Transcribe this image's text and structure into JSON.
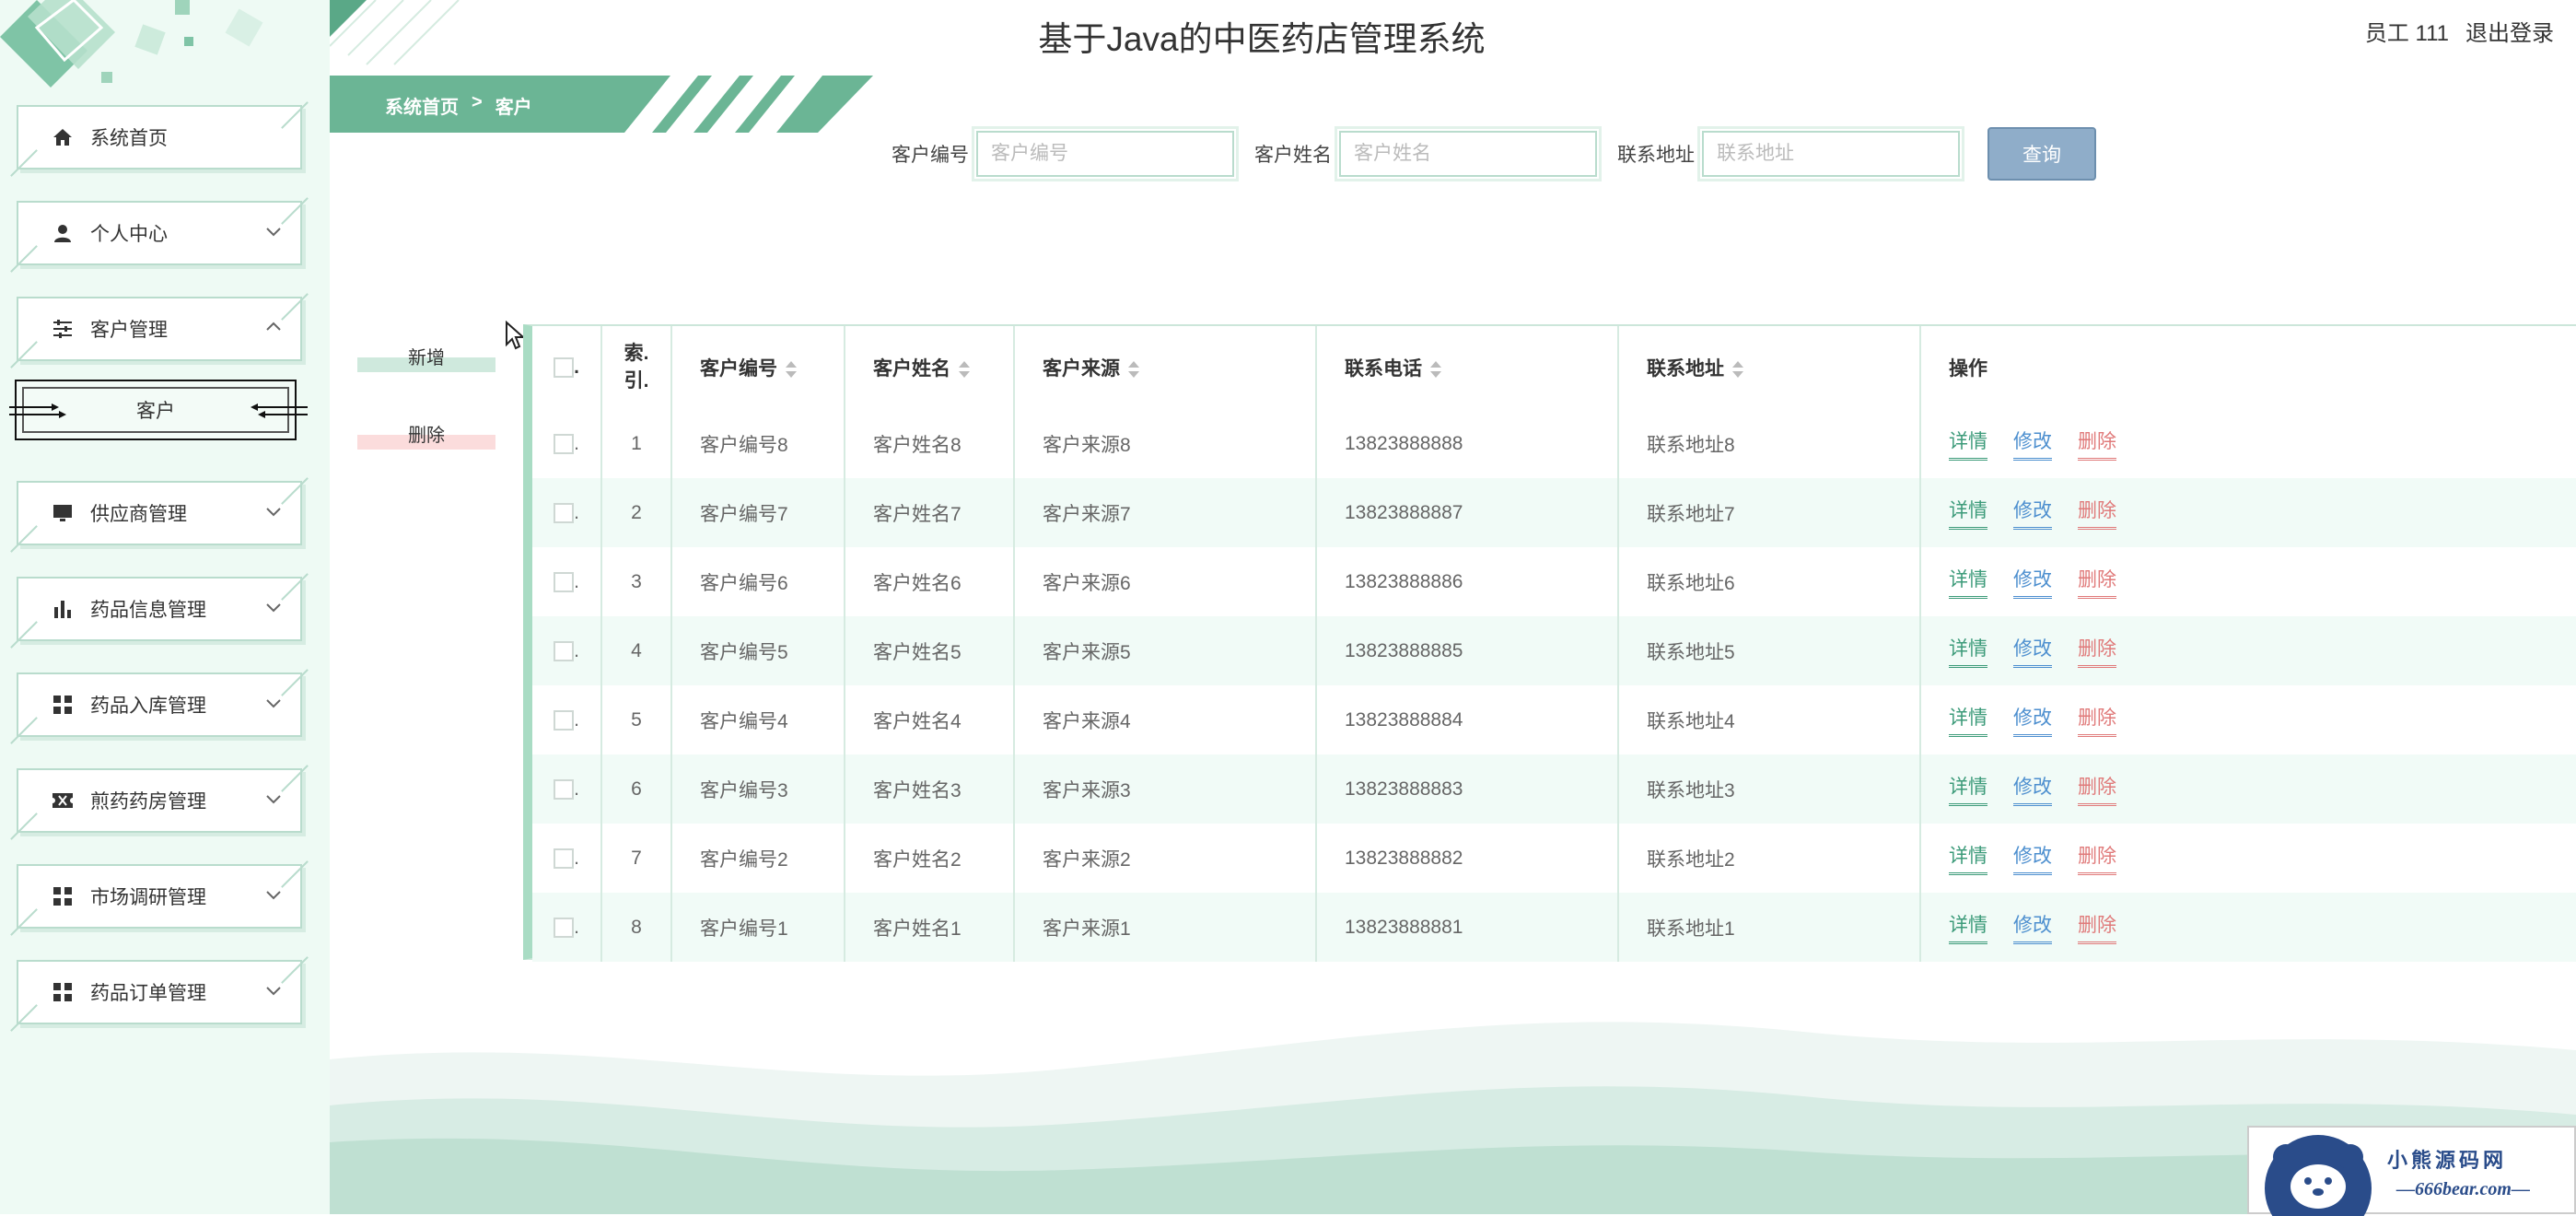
{
  "app": {
    "title": "基于Java的中医药店管理系统"
  },
  "user": {
    "name": "员工 111",
    "logout": "退出登录"
  },
  "breadcrumb": {
    "home": "系统首页",
    "separator": ">",
    "current": "客户"
  },
  "sidebar": {
    "items": [
      {
        "label": "系统首页",
        "icon": "home-icon"
      },
      {
        "label": "个人中心",
        "icon": "user-icon"
      },
      {
        "label": "客户管理",
        "icon": "sliders-icon",
        "expanded": true
      },
      {
        "label": "供应商管理",
        "icon": "monitor-icon"
      },
      {
        "label": "药品信息管理",
        "icon": "bar-chart-icon"
      },
      {
        "label": "药品入库管理",
        "icon": "grid-icon"
      },
      {
        "label": "煎药药房管理",
        "icon": "ticket-icon"
      },
      {
        "label": "市场调研管理",
        "icon": "grid-icon"
      },
      {
        "label": "药品订单管理",
        "icon": "grid-icon"
      }
    ],
    "submenu": {
      "label": "客户"
    }
  },
  "search": {
    "fields": [
      {
        "label": "客户编号",
        "placeholder": "客户编号"
      },
      {
        "label": "客户姓名",
        "placeholder": "客户姓名"
      },
      {
        "label": "联系地址",
        "placeholder": "联系地址"
      }
    ],
    "button": "查询"
  },
  "actions": {
    "add": "新增",
    "delete": "删除"
  },
  "table": {
    "headers": {
      "checkbox": ".",
      "index": "索.\n引.",
      "code": "客户编号",
      "name": "客户姓名",
      "source": "客户来源",
      "phone": "联系电话",
      "address": "联系地址",
      "ops": "操作"
    },
    "op_labels": {
      "detail": "详情",
      "edit": "修改",
      "delete": "删除"
    },
    "rows": [
      {
        "index": "1",
        "code": "客户编号8",
        "name": "客户姓名8",
        "source": "客户来源8",
        "phone": "13823888888",
        "address": "联系地址8"
      },
      {
        "index": "2",
        "code": "客户编号7",
        "name": "客户姓名7",
        "source": "客户来源7",
        "phone": "13823888887",
        "address": "联系地址7"
      },
      {
        "index": "3",
        "code": "客户编号6",
        "name": "客户姓名6",
        "source": "客户来源6",
        "phone": "13823888886",
        "address": "联系地址6"
      },
      {
        "index": "4",
        "code": "客户编号5",
        "name": "客户姓名5",
        "source": "客户来源5",
        "phone": "13823888885",
        "address": "联系地址5"
      },
      {
        "index": "5",
        "code": "客户编号4",
        "name": "客户姓名4",
        "source": "客户来源4",
        "phone": "13823888884",
        "address": "联系地址4"
      },
      {
        "index": "6",
        "code": "客户编号3",
        "name": "客户姓名3",
        "source": "客户来源3",
        "phone": "13823888883",
        "address": "联系地址3"
      },
      {
        "index": "7",
        "code": "客户编号2",
        "name": "客户姓名2",
        "source": "客户来源2",
        "phone": "13823888882",
        "address": "联系地址2"
      },
      {
        "index": "8",
        "code": "客户编号1",
        "name": "客户姓名1",
        "source": "客户来源1",
        "phone": "13823888881",
        "address": "联系地址1"
      }
    ]
  },
  "watermark": {
    "title": "小熊源码网",
    "site": "—666bear.com—"
  },
  "colors": {
    "accent": "#5aa887",
    "sidebar_bg": "#eefaf4",
    "search_button": "#8fadc9",
    "link_detail": "#3d9b7a",
    "link_edit": "#4d8fcf",
    "link_delete": "#e07a7a"
  }
}
